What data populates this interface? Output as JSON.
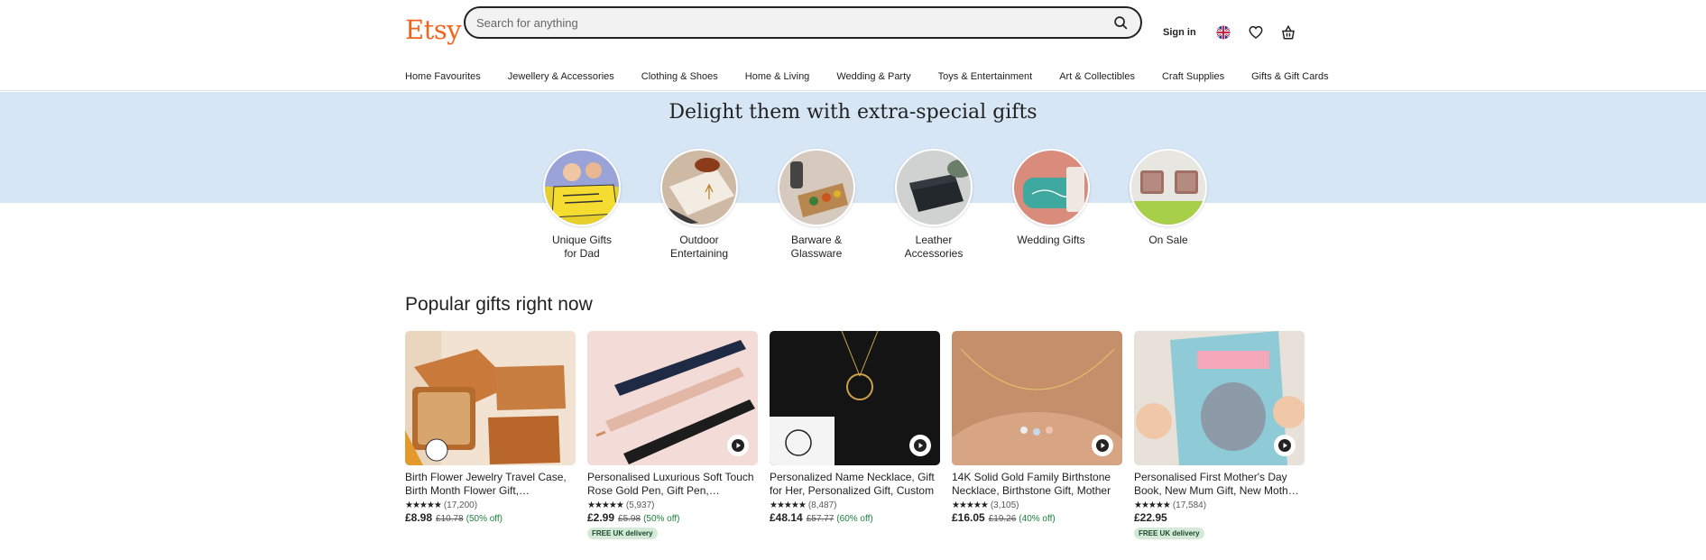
{
  "header": {
    "logo": "Etsy",
    "search_placeholder": "Search for anything",
    "sign_in": "Sign in"
  },
  "categories": [
    "Home Favourites",
    "Jewellery & Accessories",
    "Clothing & Shoes",
    "Home & Living",
    "Wedding & Party",
    "Toys & Entertainment",
    "Art & Collectibles",
    "Craft Supplies",
    "Gifts & Gift Cards"
  ],
  "banner": {
    "title": "Delight them with extra-special gifts",
    "items": [
      {
        "label": "Unique Gifts\nfor Dad"
      },
      {
        "label": "Outdoor\nEntertaining"
      },
      {
        "label": "Barware &\nGlassware"
      },
      {
        "label": "Leather\nAccessories"
      },
      {
        "label": "Wedding Gifts"
      },
      {
        "label": "On Sale"
      }
    ]
  },
  "popular": {
    "title": "Popular gifts right now",
    "products": [
      {
        "title": "Birth Flower Jewelry Travel Case, Birth Month Flower Gift, Personalized",
        "stars": "★★★★★",
        "reviews": "(17,200)",
        "price": "£8.98",
        "was": "£10.78",
        "off": "(50% off)",
        "badge": ""
      },
      {
        "title": "Personalised Luxurious Soft Touch Rose Gold Pen, Gift Pen, Engraved",
        "stars": "★★★★★",
        "reviews": "(5,937)",
        "price": "£2.99",
        "was": "£5.98",
        "off": "(50% off)",
        "badge": "FREE UK delivery"
      },
      {
        "title": "Personalized Name Necklace, Gift for Her, Personalized Gift, Custom",
        "stars": "★★★★★",
        "reviews": "(8,487)",
        "price": "£48.14",
        "was": "£57.77",
        "off": "(60% off)",
        "badge": ""
      },
      {
        "title": "14K Solid Gold Family Birthstone Necklace, Birthstone Gift, Mother",
        "stars": "★★★★★",
        "reviews": "(3,105)",
        "price": "£16.05",
        "was": "£19.26",
        "off": "(40% off)",
        "badge": ""
      },
      {
        "title": "Personalised First Mother's Day Book, New Mum Gift, New Mother Gift",
        "stars": "★★★★★",
        "reviews": "(17,584)",
        "price": "£22.95",
        "was": "",
        "off": "",
        "badge": "FREE UK delivery"
      }
    ]
  },
  "colors": {
    "brand": "#f1641e",
    "banner_bg": "#d7e6f5",
    "discount_green": "#1d7f3c"
  }
}
